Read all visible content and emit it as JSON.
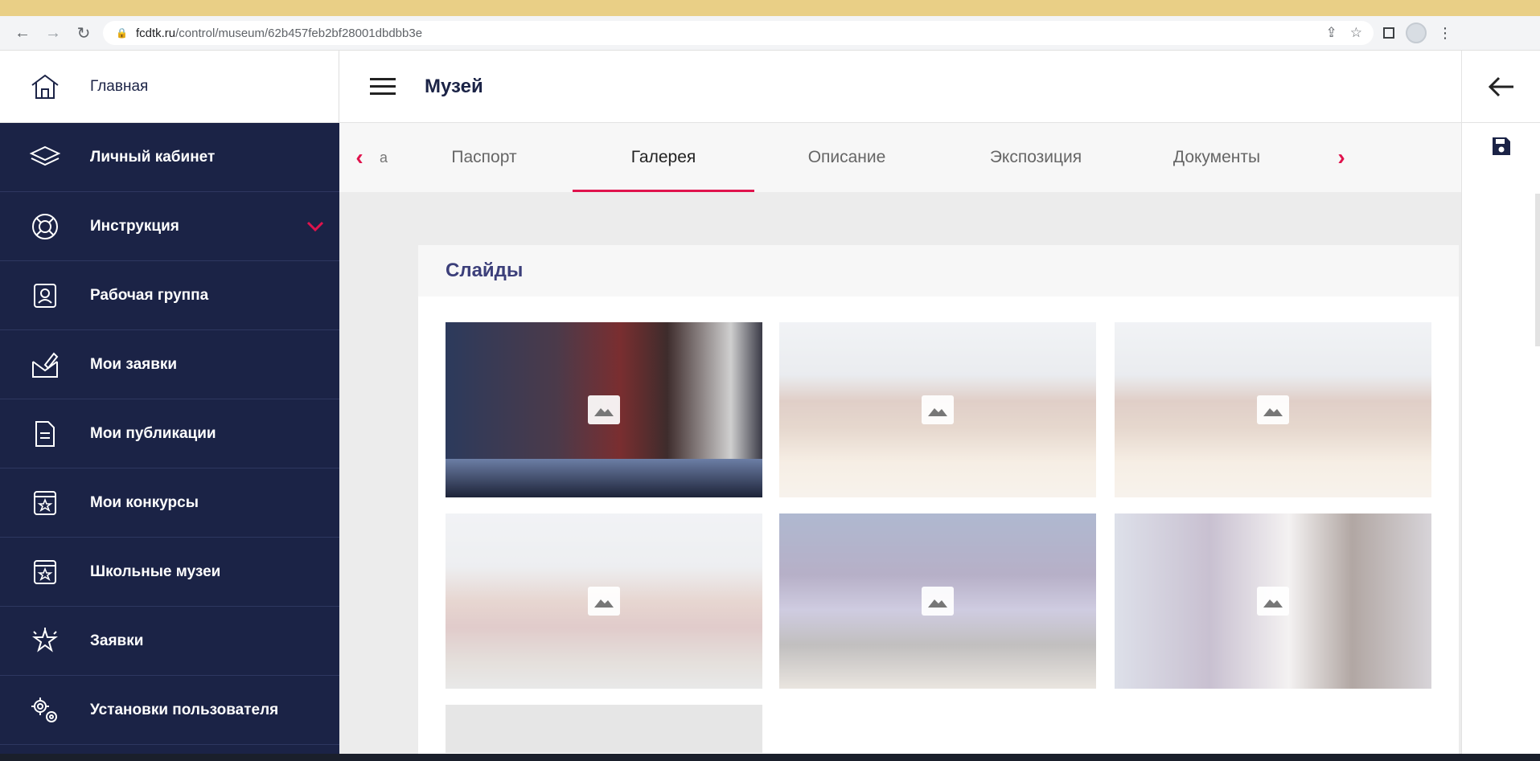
{
  "browser": {
    "url_host": "fcdtk.ru",
    "url_path": "/control/museum/62b457feb2bf28001dbdbb3e"
  },
  "sidebar": {
    "home_label": "Главная",
    "items": [
      {
        "label": "Личный кабинет",
        "icon": "layers-icon"
      },
      {
        "label": "Инструкция",
        "icon": "lifebuoy-icon",
        "expandable": true
      },
      {
        "label": "Рабочая группа",
        "icon": "user-badge-icon"
      },
      {
        "label": "Мои заявки",
        "icon": "envelope-edit-icon"
      },
      {
        "label": "Мои публикации",
        "icon": "document-icon"
      },
      {
        "label": "Мои конкурсы",
        "icon": "star-box-icon"
      },
      {
        "label": "Школьные музеи",
        "icon": "star-box-icon"
      },
      {
        "label": "Заявки",
        "icon": "star-burst-icon"
      },
      {
        "label": "Установки пользователя",
        "icon": "gears-icon"
      }
    ]
  },
  "header": {
    "title": "Музей"
  },
  "tabs": {
    "partial": "а",
    "items": [
      "Паспорт",
      "Галерея",
      "Описание",
      "Экспозиция",
      "Документы"
    ],
    "active": "Галерея"
  },
  "gallery": {
    "section_title": "Слайды",
    "slides": [
      {
        "label": "slide-1"
      },
      {
        "label": "slide-2"
      },
      {
        "label": "slide-3"
      },
      {
        "label": "slide-4"
      },
      {
        "label": "slide-5"
      },
      {
        "label": "slide-6"
      }
    ]
  },
  "colors": {
    "sidebar_bg": "#1b2346",
    "accent": "#e0134d",
    "section_title": "#3c3f7a"
  }
}
